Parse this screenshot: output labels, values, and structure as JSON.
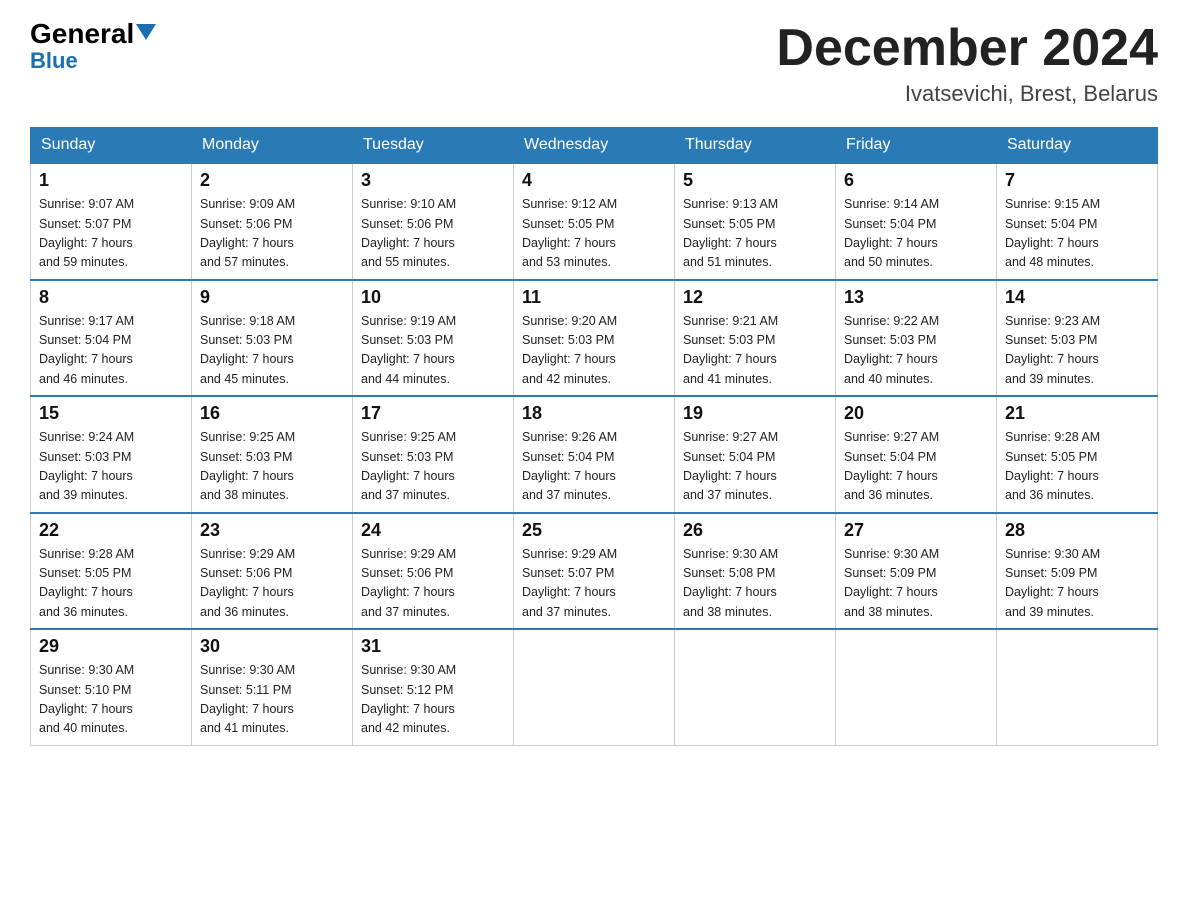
{
  "logo": {
    "general": "General",
    "blue": "Blue"
  },
  "header": {
    "title": "December 2024",
    "subtitle": "Ivatsevichi, Brest, Belarus"
  },
  "days_of_week": [
    "Sunday",
    "Monday",
    "Tuesday",
    "Wednesday",
    "Thursday",
    "Friday",
    "Saturday"
  ],
  "weeks": [
    [
      {
        "day": "1",
        "info": "Sunrise: 9:07 AM\nSunset: 5:07 PM\nDaylight: 7 hours\nand 59 minutes."
      },
      {
        "day": "2",
        "info": "Sunrise: 9:09 AM\nSunset: 5:06 PM\nDaylight: 7 hours\nand 57 minutes."
      },
      {
        "day": "3",
        "info": "Sunrise: 9:10 AM\nSunset: 5:06 PM\nDaylight: 7 hours\nand 55 minutes."
      },
      {
        "day": "4",
        "info": "Sunrise: 9:12 AM\nSunset: 5:05 PM\nDaylight: 7 hours\nand 53 minutes."
      },
      {
        "day": "5",
        "info": "Sunrise: 9:13 AM\nSunset: 5:05 PM\nDaylight: 7 hours\nand 51 minutes."
      },
      {
        "day": "6",
        "info": "Sunrise: 9:14 AM\nSunset: 5:04 PM\nDaylight: 7 hours\nand 50 minutes."
      },
      {
        "day": "7",
        "info": "Sunrise: 9:15 AM\nSunset: 5:04 PM\nDaylight: 7 hours\nand 48 minutes."
      }
    ],
    [
      {
        "day": "8",
        "info": "Sunrise: 9:17 AM\nSunset: 5:04 PM\nDaylight: 7 hours\nand 46 minutes."
      },
      {
        "day": "9",
        "info": "Sunrise: 9:18 AM\nSunset: 5:03 PM\nDaylight: 7 hours\nand 45 minutes."
      },
      {
        "day": "10",
        "info": "Sunrise: 9:19 AM\nSunset: 5:03 PM\nDaylight: 7 hours\nand 44 minutes."
      },
      {
        "day": "11",
        "info": "Sunrise: 9:20 AM\nSunset: 5:03 PM\nDaylight: 7 hours\nand 42 minutes."
      },
      {
        "day": "12",
        "info": "Sunrise: 9:21 AM\nSunset: 5:03 PM\nDaylight: 7 hours\nand 41 minutes."
      },
      {
        "day": "13",
        "info": "Sunrise: 9:22 AM\nSunset: 5:03 PM\nDaylight: 7 hours\nand 40 minutes."
      },
      {
        "day": "14",
        "info": "Sunrise: 9:23 AM\nSunset: 5:03 PM\nDaylight: 7 hours\nand 39 minutes."
      }
    ],
    [
      {
        "day": "15",
        "info": "Sunrise: 9:24 AM\nSunset: 5:03 PM\nDaylight: 7 hours\nand 39 minutes."
      },
      {
        "day": "16",
        "info": "Sunrise: 9:25 AM\nSunset: 5:03 PM\nDaylight: 7 hours\nand 38 minutes."
      },
      {
        "day": "17",
        "info": "Sunrise: 9:25 AM\nSunset: 5:03 PM\nDaylight: 7 hours\nand 37 minutes."
      },
      {
        "day": "18",
        "info": "Sunrise: 9:26 AM\nSunset: 5:04 PM\nDaylight: 7 hours\nand 37 minutes."
      },
      {
        "day": "19",
        "info": "Sunrise: 9:27 AM\nSunset: 5:04 PM\nDaylight: 7 hours\nand 37 minutes."
      },
      {
        "day": "20",
        "info": "Sunrise: 9:27 AM\nSunset: 5:04 PM\nDaylight: 7 hours\nand 36 minutes."
      },
      {
        "day": "21",
        "info": "Sunrise: 9:28 AM\nSunset: 5:05 PM\nDaylight: 7 hours\nand 36 minutes."
      }
    ],
    [
      {
        "day": "22",
        "info": "Sunrise: 9:28 AM\nSunset: 5:05 PM\nDaylight: 7 hours\nand 36 minutes."
      },
      {
        "day": "23",
        "info": "Sunrise: 9:29 AM\nSunset: 5:06 PM\nDaylight: 7 hours\nand 36 minutes."
      },
      {
        "day": "24",
        "info": "Sunrise: 9:29 AM\nSunset: 5:06 PM\nDaylight: 7 hours\nand 37 minutes."
      },
      {
        "day": "25",
        "info": "Sunrise: 9:29 AM\nSunset: 5:07 PM\nDaylight: 7 hours\nand 37 minutes."
      },
      {
        "day": "26",
        "info": "Sunrise: 9:30 AM\nSunset: 5:08 PM\nDaylight: 7 hours\nand 38 minutes."
      },
      {
        "day": "27",
        "info": "Sunrise: 9:30 AM\nSunset: 5:09 PM\nDaylight: 7 hours\nand 38 minutes."
      },
      {
        "day": "28",
        "info": "Sunrise: 9:30 AM\nSunset: 5:09 PM\nDaylight: 7 hours\nand 39 minutes."
      }
    ],
    [
      {
        "day": "29",
        "info": "Sunrise: 9:30 AM\nSunset: 5:10 PM\nDaylight: 7 hours\nand 40 minutes."
      },
      {
        "day": "30",
        "info": "Sunrise: 9:30 AM\nSunset: 5:11 PM\nDaylight: 7 hours\nand 41 minutes."
      },
      {
        "day": "31",
        "info": "Sunrise: 9:30 AM\nSunset: 5:12 PM\nDaylight: 7 hours\nand 42 minutes."
      },
      null,
      null,
      null,
      null
    ]
  ]
}
